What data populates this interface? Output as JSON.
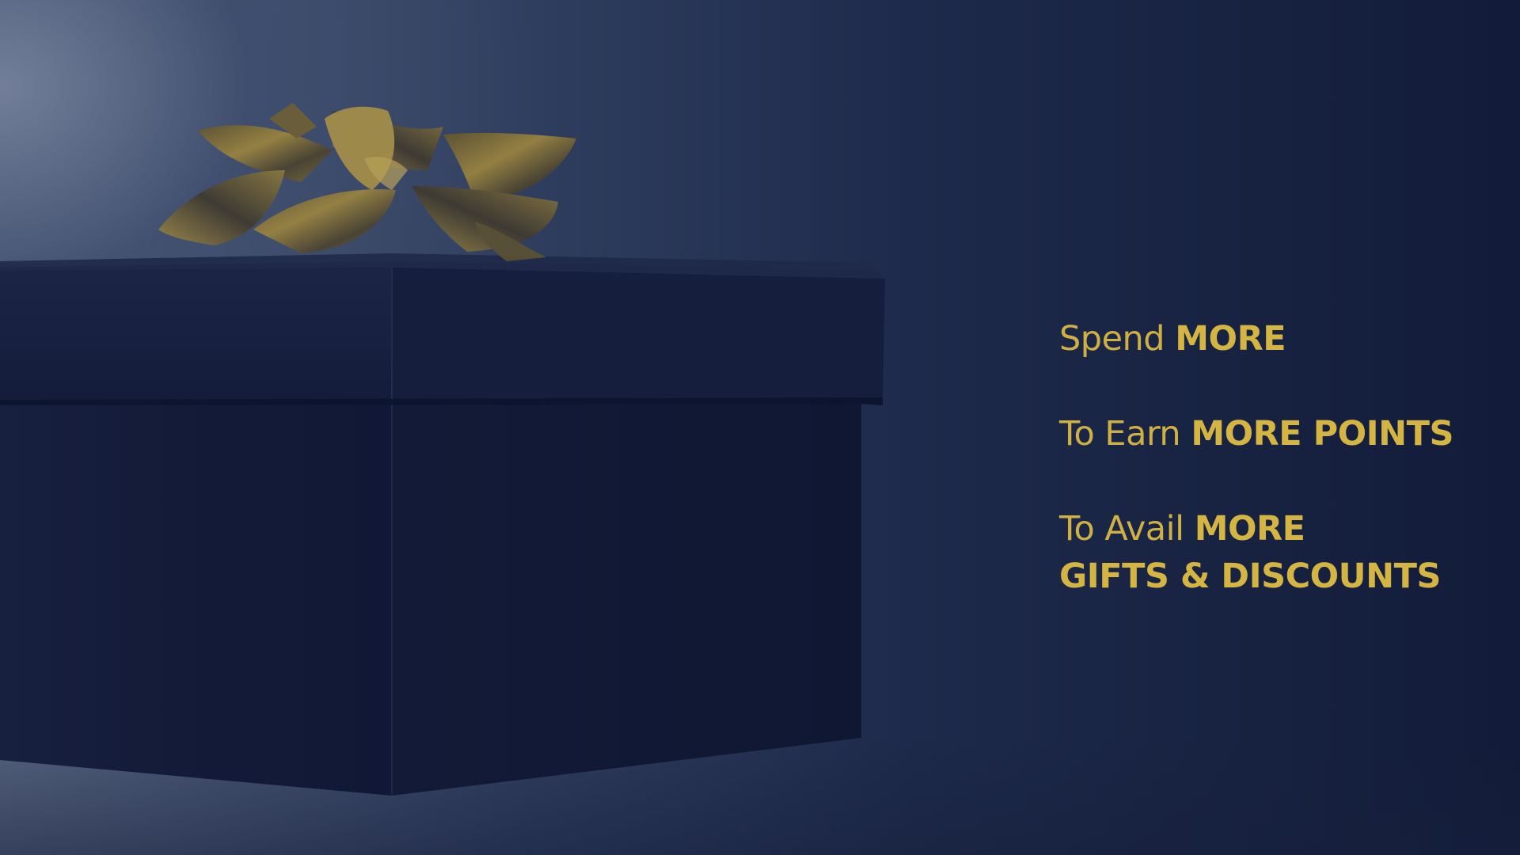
{
  "promo": {
    "line1": {
      "lead": "Spend ",
      "emphasis": "MORE"
    },
    "line2": {
      "lead": "To Earn ",
      "emphasis": "MORE POINTS"
    },
    "line3": {
      "lead": "To Avail ",
      "emphasis": "MORE",
      "emphasis2": "GIFTS & DISCOUNTS"
    }
  },
  "colors": {
    "text_gold": "#d4b544",
    "box_navy": "#141d3b",
    "ribbon_gold": "#8a7330",
    "background_dark": "#121c39"
  },
  "icons": {
    "hero_image": "gift-box-with-gold-bow"
  }
}
